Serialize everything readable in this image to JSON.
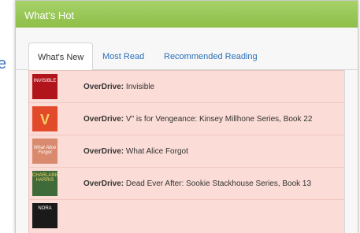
{
  "background": {
    "partial_text": "e"
  },
  "widget": {
    "title": "What's Hot",
    "tabs": [
      {
        "label": "What's New",
        "active": true
      },
      {
        "label": "Most Read",
        "active": false
      },
      {
        "label": "Recommended Reading",
        "active": false
      }
    ],
    "items": [
      {
        "source": "OverDrive:",
        "title": "Invisible",
        "cover_text": "INVISIBLE",
        "cover_color": "#b2141c"
      },
      {
        "source": "OverDrive:",
        "title": "V\" is for Vengeance: Kinsey Millhone Series, Book 22",
        "cover_text": "V",
        "cover_color": "#e24a2a"
      },
      {
        "source": "OverDrive:",
        "title": "What Alice Forgot",
        "cover_text": "What Alice Forgot",
        "cover_color": "#d98a6e"
      },
      {
        "source": "OverDrive:",
        "title": "Dead Ever After: Sookie Stackhouse Series, Book 13",
        "cover_text": "CHARLAINE HARRIS",
        "cover_color": "#3f6b3a"
      },
      {
        "source": "",
        "title": "",
        "cover_text": "NORA",
        "cover_color": "#1a1a1a"
      }
    ]
  },
  "colors": {
    "header_green": "#9ac856",
    "list_background": "#fbdcd6",
    "link_blue": "#2a6fb8"
  }
}
